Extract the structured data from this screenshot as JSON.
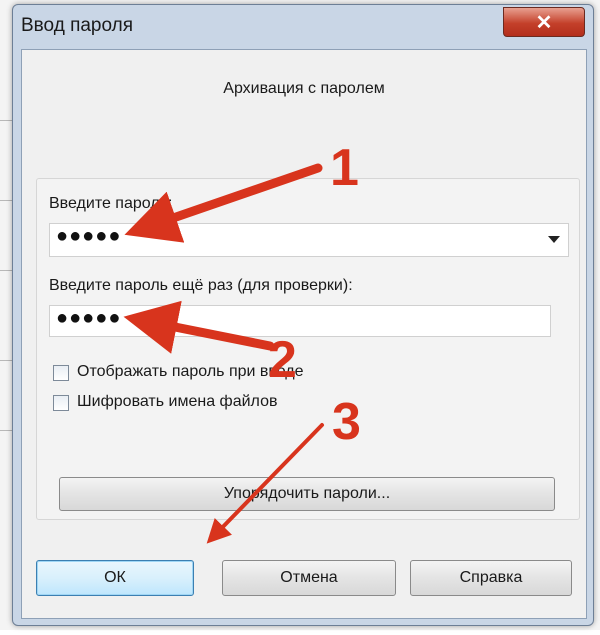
{
  "dialog": {
    "title": "Ввод пароля",
    "close_glyph": "✕",
    "subtitle": "Архивация с паролем",
    "password_label": "Введите пароль:",
    "password_value": "●●●●●",
    "confirm_label": "Введите пароль ещё раз (для проверки):",
    "confirm_value": "●●●●●",
    "show_password_label": "Отображать пароль при вводе",
    "show_password_checked": false,
    "encrypt_names_label": "Шифровать имена файлов",
    "encrypt_names_checked": false,
    "organize_button": "Упорядочить пароли...",
    "ok_button": "ОК",
    "cancel_button": "Отмена",
    "help_button": "Справка"
  },
  "annotations": {
    "step1": "1",
    "step2": "2",
    "step3": "3",
    "arrow_color": "#d8341d"
  }
}
